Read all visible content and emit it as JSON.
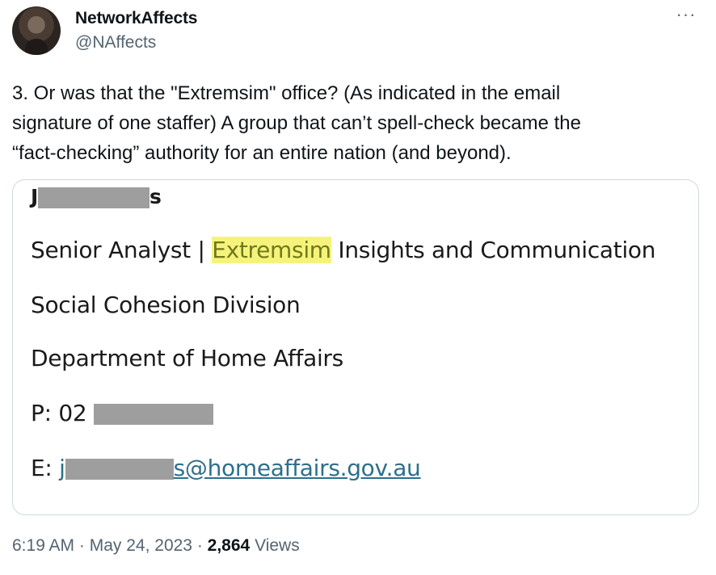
{
  "author": {
    "display_name": "NetworkAffects",
    "handle": "@NAffects"
  },
  "more_label": "···",
  "tweet_text": "3.  Or was that the \"Extremsim\" office? (As indicated in the email\nsignature of one staffer) A group that can’t spell-check became the\n“fact-checking” authority for an entire nation (and beyond).",
  "signature": {
    "name_start": "J",
    "name_end": "s",
    "title_before": "Senior Analyst | ",
    "title_highlight": "Extremsim",
    "title_after": " Insights and Communication",
    "division": "Social Cohesion Division",
    "department": "Department of Home Affairs",
    "phone_prefix": "P: 02",
    "email_prefix": "E: ",
    "email_start": "j",
    "email_end": "s@homeaffairs.gov.au"
  },
  "meta": {
    "time": "6:19 AM",
    "sep": " · ",
    "date": "May 24, 2023",
    "views_count": "2,864",
    "views_label": " Views"
  }
}
